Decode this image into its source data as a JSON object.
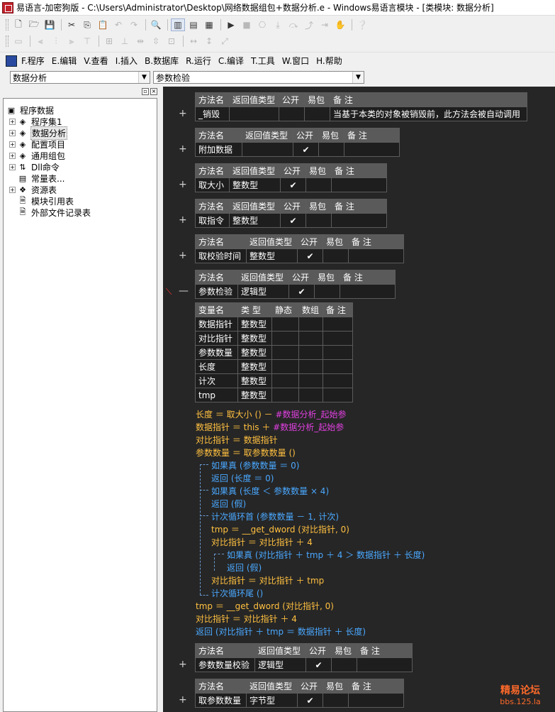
{
  "window": {
    "title": "易语言-加密狗版 - C:\\Users\\Administrator\\Desktop\\网络数据组包+数据分析.e - Windows易语言模块 - [类模块: 数据分析]"
  },
  "menu": [
    "F.程序",
    "E.编辑",
    "V.查看",
    "I.插入",
    "B.数据库",
    "R.运行",
    "C.编译",
    "T.工具",
    "W.窗口",
    "H.帮助"
  ],
  "combos": {
    "left": "数据分析",
    "right": "参数检验"
  },
  "tree": {
    "root": "程序数据",
    "items": [
      "程序集1",
      "数据分析",
      "配置项目",
      "通用组包",
      "Dll命令",
      "常量表...",
      "资源表",
      "模块引用表",
      "外部文件记录表"
    ]
  },
  "headers": {
    "method": "方法名",
    "ret": "返回值类型",
    "public": "公开",
    "easy": "易包",
    "note": "备 注",
    "var": "变量名",
    "type": "类 型",
    "static": "静态",
    "array": "数组",
    "check": "✔"
  },
  "methods": [
    {
      "name": "_销毁",
      "ret": "",
      "pub": false,
      "note": "当基于本类的对象被销毁前，此方法会被自动调用"
    },
    {
      "name": "附加数据",
      "ret": "",
      "pub": true,
      "note": ""
    },
    {
      "name": "取大小",
      "ret": "整数型",
      "pub": true,
      "note": ""
    },
    {
      "name": "取指令",
      "ret": "整数型",
      "pub": true,
      "note": ""
    },
    {
      "name": "取校验时间",
      "ret": "整数型",
      "pub": true,
      "note": ""
    },
    {
      "name": "参数检验",
      "ret": "逻辑型",
      "pub": true,
      "note": ""
    },
    {
      "name": "参数数量校验",
      "ret": "逻辑型",
      "pub": true,
      "note": ""
    },
    {
      "name": "取参数数量",
      "ret": "字节型",
      "pub": true,
      "note": ""
    }
  ],
  "vars": [
    {
      "name": "数据指针",
      "type": "整数型"
    },
    {
      "name": "对比指针",
      "type": "整数型"
    },
    {
      "name": "参数数量",
      "type": "整数型"
    },
    {
      "name": "长度",
      "type": "整数型"
    },
    {
      "name": "计次",
      "type": "整数型"
    },
    {
      "name": "tmp",
      "type": "整数型"
    }
  ],
  "plus": "+",
  "minus": "—",
  "code": [
    {
      "t": "长度 ＝ 取大小 () － ",
      "c": "#数据分析_起始参"
    },
    {
      "t": "数据指针 ＝ this ＋ ",
      "c": "#数据分析_起始参"
    },
    {
      "t": "对比指针 ＝ 数据指针"
    },
    {
      "t": "参数数量 ＝ 取参数数量 ()"
    },
    {
      "t": "如果真 (参数数量 ＝ 0)"
    },
    {
      "t": "返回 (长度 ＝ 0)"
    },
    {
      "t": "如果真 (长度 ＜ 参数数量 × 4)"
    },
    {
      "t": "返回 (假)"
    },
    {
      "t": "计次循环首 (参数数量 － 1, 计次)"
    },
    {
      "t": "tmp ＝ __get_dword (对比指针, 0)"
    },
    {
      "t": "对比指针 ＝ 对比指针 ＋ 4"
    },
    {
      "t": "如果真 (对比指针 ＋ tmp ＋ 4 ＞ 数据指针 ＋ 长度)"
    },
    {
      "t": "返回 (假)"
    },
    {
      "t": "对比指针 ＝ 对比指针 ＋ tmp"
    },
    {
      "t": "计次循环尾 ()"
    },
    {
      "t": "tmp ＝ __get_dword (对比指针, 0)"
    },
    {
      "t": "对比指针 ＝ 对比指针 ＋ 4"
    },
    {
      "t": "返回 (对比指针 ＋ tmp ＝ 数据指针 ＋ 长度)"
    }
  ],
  "watermark": {
    "line1": "精易论坛",
    "line2": "bbs.125.la"
  },
  "colors": {
    "editor_bg": "#262626",
    "header_bg": "#5a5a5a",
    "var_red": "#ff4f5a",
    "op_orange": "#ffc040",
    "kw_blue": "#4aa8ff",
    "const_magenta": "#e040e0",
    "note_green": "#5fbf4f",
    "check_pink": "#ff3c7a"
  }
}
